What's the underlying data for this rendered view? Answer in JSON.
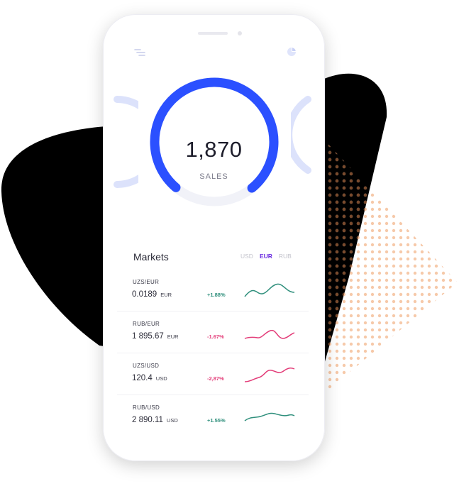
{
  "header": {
    "menu_icon": "filter-lines-icon",
    "chart_icon": "pie-chart-icon"
  },
  "gauge": {
    "value": "1,870",
    "label": "SALES",
    "progress": 0.78,
    "color": "#2b50ff",
    "track_color": "#f1f2f8",
    "side_color": "#dce2fb"
  },
  "markets": {
    "title": "Markets",
    "currencies": [
      "USD",
      "EUR",
      "RUB"
    ],
    "selected_currency": "EUR",
    "rows": [
      {
        "pair": "UZS/EUR",
        "price": "0.0189",
        "unit": "EUR",
        "change": "+1.88%",
        "trend": "up",
        "color": "#2f8f7c"
      },
      {
        "pair": "RUB/EUR",
        "price": "1 895.67",
        "unit": "EUR",
        "change": "-1.67%",
        "trend": "down",
        "color": "#e33d79"
      },
      {
        "pair": "UZS/USD",
        "price": "120.4",
        "unit": "USD",
        "change": "-2,87%",
        "trend": "down",
        "color": "#e33d79"
      },
      {
        "pair": "RUB/USD",
        "price": "2 890.11",
        "unit": "USD",
        "change": "+1.55%",
        "trend": "up",
        "color": "#2f8f7c"
      }
    ]
  },
  "colors": {
    "blob": "#000000",
    "dots_dark": "#7a4a2c",
    "dots_light": "#f6c9a9"
  }
}
